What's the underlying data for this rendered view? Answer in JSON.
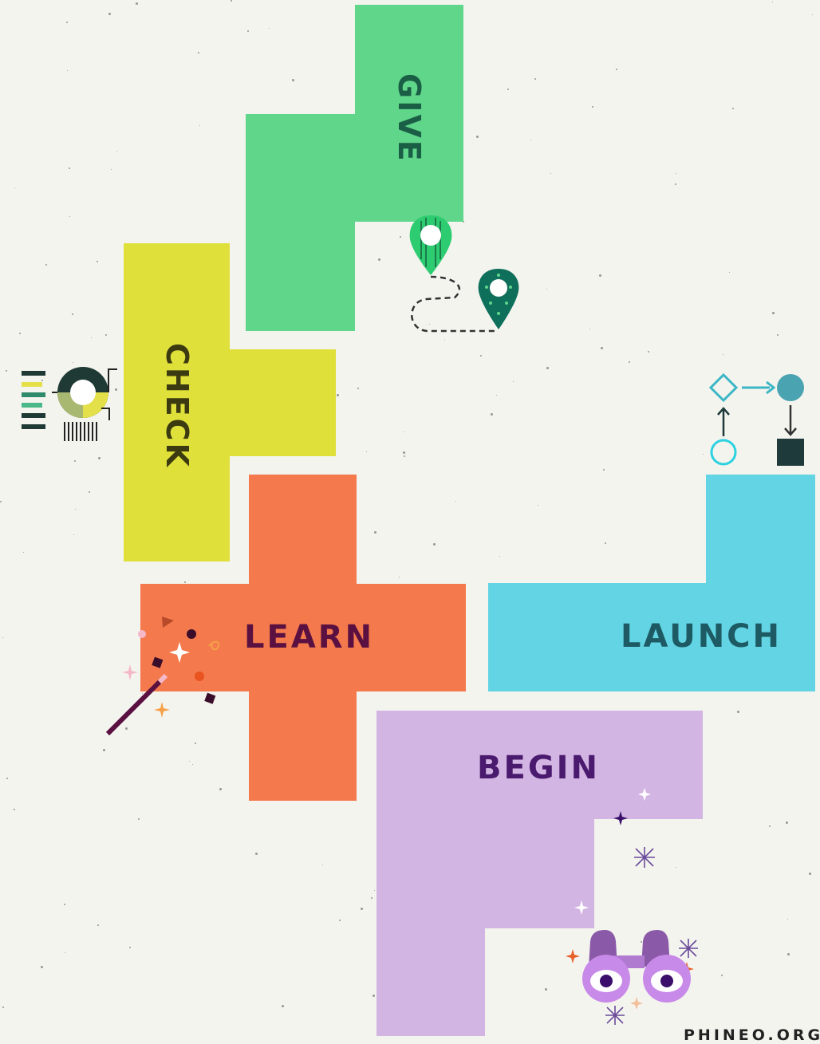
{
  "tiles": {
    "give": {
      "label": "GIVE",
      "color": "#5fd68a",
      "text_color": "#1b5e46"
    },
    "check": {
      "label": "CHECK",
      "color": "#dfe03a",
      "text_color": "#3c3a10"
    },
    "learn": {
      "label": "LEARN",
      "color": "#f47a4d",
      "text_color": "#5a1040"
    },
    "launch": {
      "label": "LAUNCH",
      "color": "#62d4e3",
      "text_color": "#1d5a63"
    },
    "begin": {
      "label": "BEGIN",
      "color": "#d3b5e3",
      "text_color": "#4a1a6e"
    }
  },
  "icons": {
    "give": "map-pins-path-icon",
    "check": "chart-dashboard-icon",
    "learn": "magic-wand-icon",
    "launch": "flowchart-icon",
    "begin": "binoculars-icon"
  },
  "footer": {
    "site": "PHINEO.ORG"
  }
}
